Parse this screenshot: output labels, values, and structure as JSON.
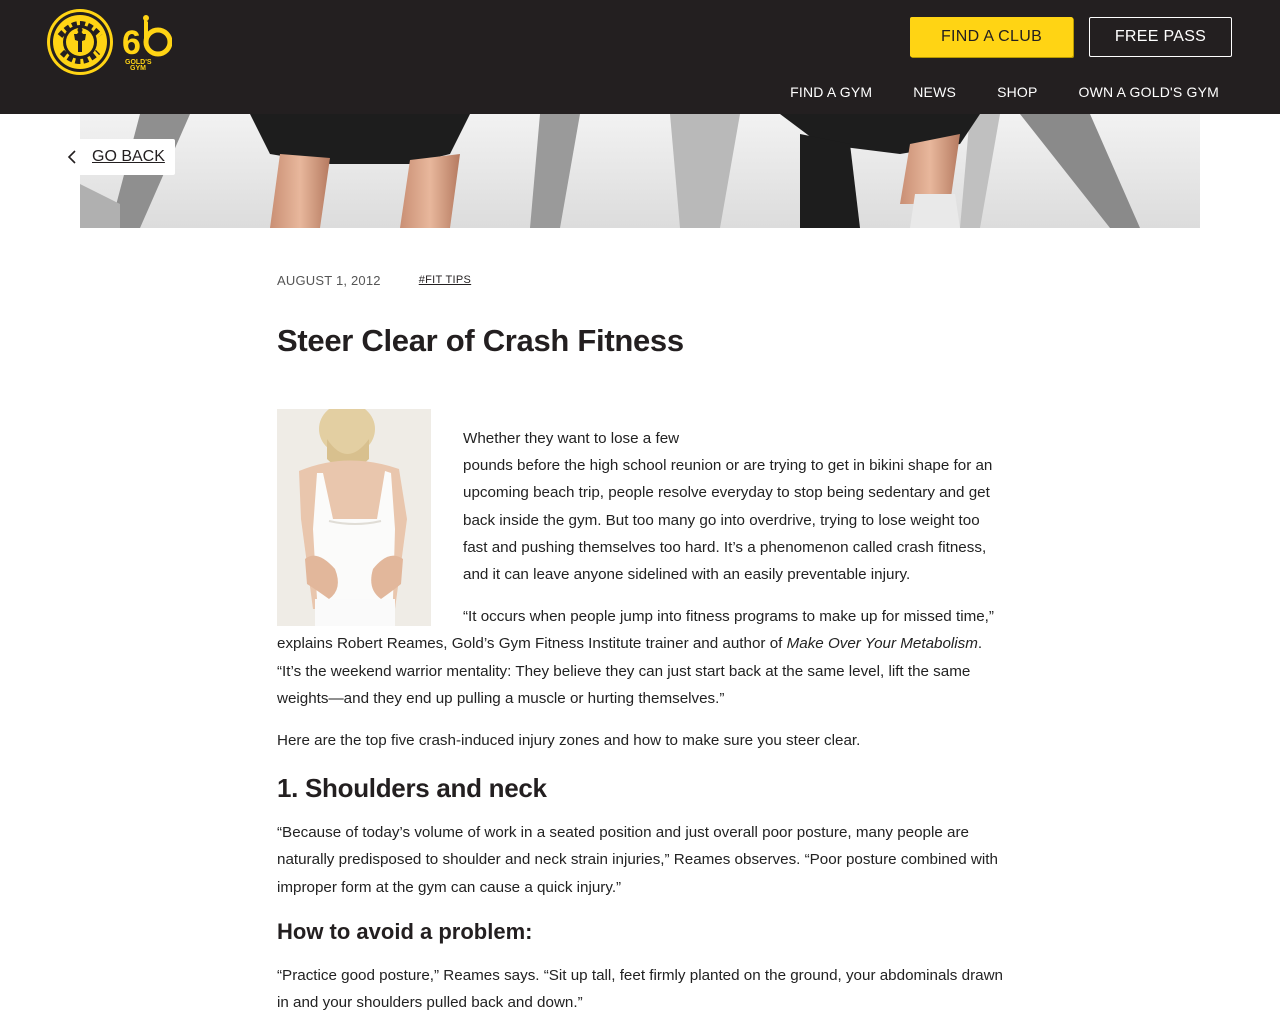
{
  "header": {
    "logo_alt": "Gold's Gym",
    "anniversary_badge": "60 Gold's Gym",
    "find_club_label": "FIND A CLUB",
    "free_pass_label": "FREE PASS",
    "nav": [
      {
        "label": "FIND A GYM"
      },
      {
        "label": "NEWS"
      },
      {
        "label": "SHOP"
      },
      {
        "label": "OWN A GOLD'S GYM"
      }
    ]
  },
  "go_back_label": "GO BACK",
  "article": {
    "date": "AUGUST 1, 2012",
    "tag": "#FIT TIPS",
    "title": "Steer Clear of Crash Fitness",
    "p1_lead": "Whether they want to lose a few",
    "p1_rest": "pounds before the high school reunion or are trying to get in bikini shape for an upcoming beach trip, people resolve everyday to stop being sedentary and get back inside the gym. But too many go into overdrive, trying to lose weight too fast and pushing themselves too hard. It’s a phenomenon called crash fitness, and it can leave anyone sidelined with an easily preventable injury.",
    "p2_a": "“It occurs when people jump into fitness programs to make up for missed time,” explains Robert Reames, Gold’s Gym Fitness Institute trainer and author of ",
    "p2_book": "Make Over Your Metabolism",
    "p2_b": ". “It’s the weekend warrior mentality: They believe they can just start back at the same level, lift the same weights—and they end up pulling a muscle or hurting themselves.”",
    "p3": "Here are the top five crash-induced injury zones and how to make sure you steer clear.",
    "h_shoulders": "1. Shoulders and neck",
    "p4": "“Because of today’s volume of work in a seated position and just overall poor posture, many people are naturally predisposed to shoulder and neck strain injuries,” Reames observes. “Poor posture combined with improper form at the gym can cause a quick injury.”",
    "h_avoid": "How to avoid a problem:",
    "p5": "“Practice good posture,” Reames says. “Sit up tall, feet firmly planted on the ground, your abdominals drawn in and your shoulders pulled back and down.”"
  },
  "colors": {
    "header_bg": "#231f20",
    "brand_yellow": "#ffd414",
    "text": "#222222"
  },
  "icons": [
    "golds-gym-logo-icon",
    "anniversary-60-icon",
    "chevron-left-icon"
  ]
}
